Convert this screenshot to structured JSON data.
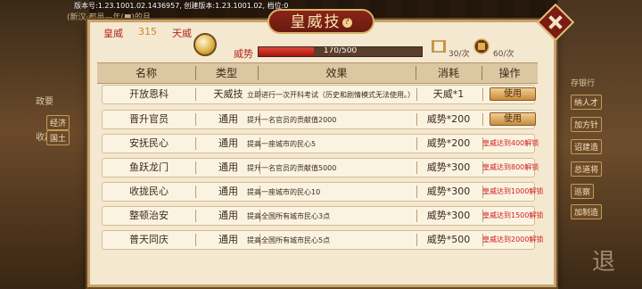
{
  "version_text": "版本号:1.23.1001.02.1436957, 创建版本:1.23.1001.02, 档位:0",
  "background": {
    "top_line": "(新汉·都邑—年(■)的月",
    "left_labels": [
      "政要",
      "收起"
    ],
    "left_small": [
      "经济",
      "国土"
    ],
    "right_buttons": [
      "纳人才",
      "加方针",
      "诏建造",
      "总道将",
      "巡察",
      "加制造"
    ],
    "right_top": "存银行",
    "corner": "退"
  },
  "dialog": {
    "title": "皇威技",
    "help_symbol": "?",
    "stats": {
      "huangwei_label": "皇威",
      "huangwei_value": "315",
      "tianwei_label": "天威",
      "weishi_label": "威势",
      "weishi_progress": "170/500",
      "weishi_current": 170,
      "weishi_max": 500,
      "scroll_count": "30/次",
      "seal_count": "60/次"
    },
    "columns": {
      "name": "名称",
      "type": "类型",
      "effect": "效果",
      "cost": "消耗",
      "op": "操作"
    },
    "rows": [
      {
        "name": "开放恩科",
        "type": "天威技",
        "effect": "立即进行一次开科考试（历史和剧情模式无法使用。）",
        "cost": "天威*1",
        "op": "使用",
        "usable": true
      },
      {
        "name": "晋升官员",
        "type": "通用",
        "effect": "提升一名官员的贡献值2000",
        "cost": "威势*200",
        "op": "使用",
        "usable": true
      },
      {
        "name": "安抚民心",
        "type": "通用",
        "effect": "提高一座城市的民心5",
        "cost": "威势*200",
        "op": "皇威达到400解锁",
        "usable": false
      },
      {
        "name": "鱼跃龙门",
        "type": "通用",
        "effect": "提升一名官员的贡献值5000",
        "cost": "威势*300",
        "op": "皇威达到800解锁",
        "usable": false
      },
      {
        "name": "收拢民心",
        "type": "通用",
        "effect": "提高一座城市的民心10",
        "cost": "威势*300",
        "op": "皇威达到1000解锁",
        "usable": false
      },
      {
        "name": "整顿治安",
        "type": "通用",
        "effect": "提高全国所有城市民心3点",
        "cost": "威势*300",
        "op": "皇威达到1500解锁",
        "usable": false
      },
      {
        "name": "普天同庆",
        "type": "通用",
        "effect": "提高全国所有城市民心5点",
        "cost": "威势*500",
        "op": "皇威达到2000解锁",
        "usable": false
      }
    ]
  }
}
